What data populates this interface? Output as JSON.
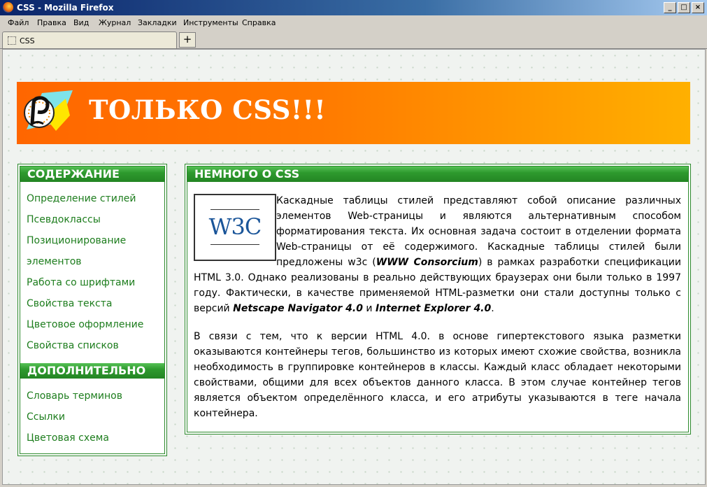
{
  "window": {
    "title": "CSS - Mozilla Firefox",
    "buttons": [
      "_",
      "□",
      "×"
    ]
  },
  "menu": [
    "Файл",
    "Правка",
    "Вид",
    "Журнал",
    "Закладки",
    "Инструменты",
    "Справка"
  ],
  "tabs": [
    {
      "label": "CSS"
    }
  ],
  "newtab_label": "+",
  "banner": {
    "title": "ТОЛЬКО CSS!!!"
  },
  "sidebar": {
    "section1": {
      "title": "СОДЕРЖАНИЕ",
      "links": [
        "Определение стилей",
        "Псевдоклассы",
        "Позиционирование",
        "элементов",
        "Работа со шрифтами",
        "Свойства текста",
        "Цветовое оформление",
        "Свойства списков"
      ]
    },
    "section2": {
      "title": "ДОПОЛНИТЕЛЬНО",
      "links": [
        "Словарь терминов",
        "Ссылки",
        "Цветовая схема"
      ]
    }
  },
  "main": {
    "title": "НЕМНОГО О CSS",
    "logo_text": "W3C",
    "p1": {
      "a": "Каскадные таблицы стилей представляют собой описание различных элементов Web-страницы и являются альтернативным способом форматирования текста. Их основная задача состоит в отделении формата Web-страницы от её содержимого. Каскадные таблицы стилей были предложены w3c (",
      "b": "WWW Consorcium",
      "c": ") в рамках разработки спецификации HTML 3.0. Однако реализованы в реально действующих браузерах они были только в 1997 году. Фактически, в качестве применяемой HTML-разметки они стали доступны только с версий ",
      "d": "Netscape Navigator 4.0",
      "e": " и ",
      "f": "Internet Explorer 4.0",
      "g": "."
    },
    "p2": "В связи с тем, что к версии HTML 4.0. в основе гипертекстового языка разметки оказываются контейнеры тегов, большинство из которых имеют схожие свойства, возникла необходимость в группировке контейнеров в классы. Каждый класс обладает некоторыми свойствами, общими для всех объектов данного класса. В этом случае контейнер тегов является объектом определённого класса, и его атрибуты указываются в теге начала контейнера."
  }
}
